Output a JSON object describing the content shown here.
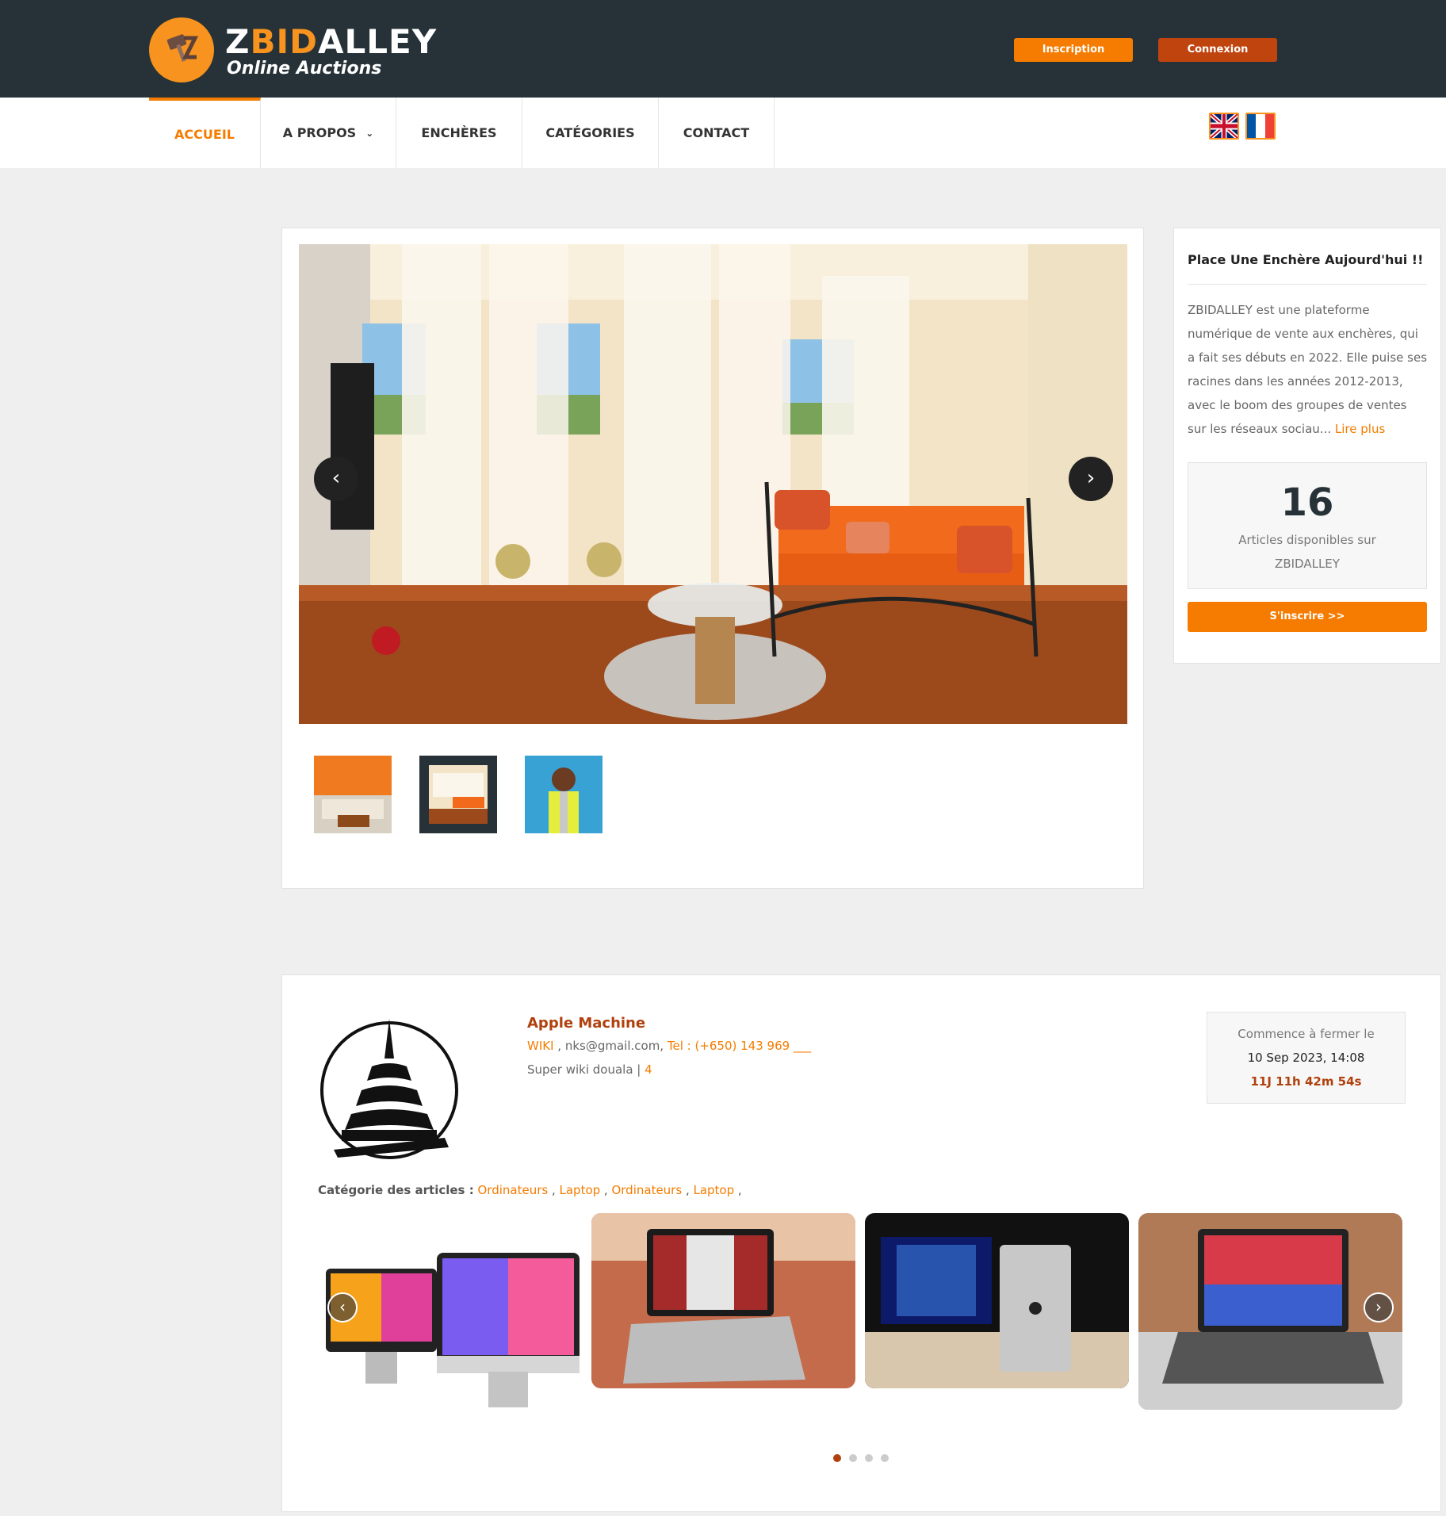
{
  "header": {
    "logo_word_a": "Z",
    "logo_word_b": "BID",
    "logo_word_c": "ALLEY",
    "logo_tagline": "Online Auctions",
    "inscription_label": "Inscription",
    "connexion_label": "Connexion"
  },
  "nav": {
    "items": [
      {
        "label": "ACCUEIL",
        "active": true
      },
      {
        "label": "A PROPOS",
        "has_dropdown": true,
        "dropdown_icon": "chevron-down-icon"
      },
      {
        "label": "ENCHÈRES"
      },
      {
        "label": "CATÉGORIES"
      },
      {
        "label": "CONTACT"
      }
    ],
    "languages": [
      "english-flag-icon",
      "french-flag-icon"
    ]
  },
  "hero": {
    "prev_icon": "chevron-left-icon",
    "next_icon": "chevron-right-icon",
    "selected_thumb": 2,
    "thumb_count": 3
  },
  "sidebar": {
    "title": "Place Une Enchère Aujourd'hui !!",
    "description": "ZBIDALLEY est une plateforme numérique de vente aux enchères, qui a fait ses débuts en 2022. Elle puise ses racines dans les années 2012-2013, avec le boom des groupes de ventes sur les réseaux sociau...",
    "read_more": "Lire plus",
    "count": "16",
    "count_label": "Articles disponibles sur ZBIDALLEY",
    "button_label": "S'inscrire >>"
  },
  "auction": {
    "seller_name": "Apple Machine",
    "wiki_label": "WIKI",
    "email": ", nks@gmail.com,",
    "tel": "Tel : (+650) 143 969 ___",
    "location": "Super wiki douala |",
    "rating": "4",
    "close_label": "Commence à fermer le",
    "close_date": "10 Sep 2023, 14:08",
    "countdown": "11J 11h 42m 54s",
    "categories_label": "Catégorie des articles :",
    "categories": [
      "Ordinateurs",
      "Laptop",
      "Ordinateurs",
      "Laptop"
    ],
    "carousel_prev_icon": "chevron-left-icon",
    "carousel_next_icon": "chevron-right-icon",
    "dots_total": 4,
    "dots_active": 1
  },
  "colors": {
    "accent": "#f57c00",
    "accent_dark": "#b0400c",
    "topbar": "#263238"
  }
}
